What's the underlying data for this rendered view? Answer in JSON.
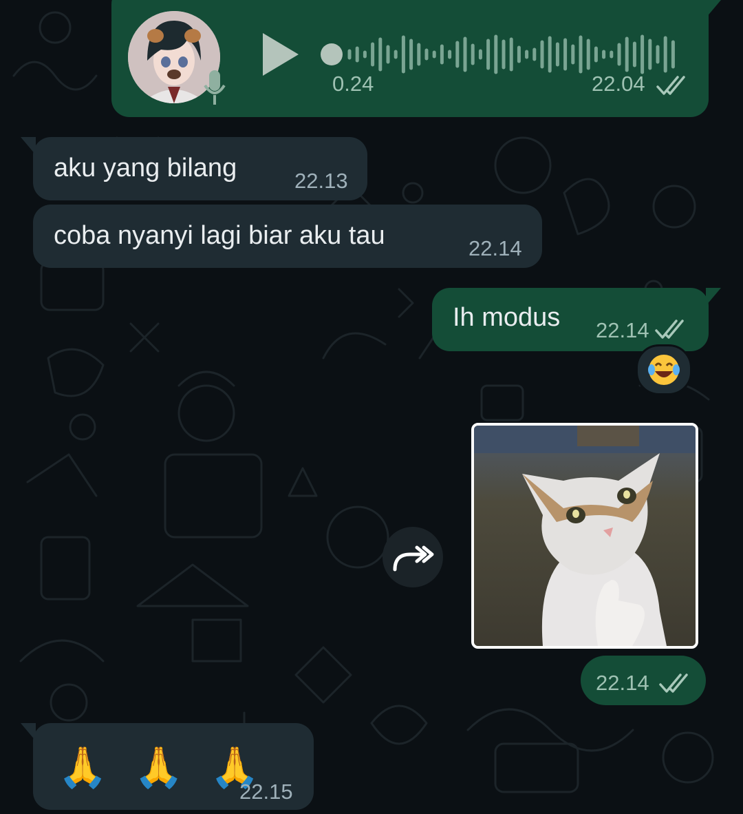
{
  "theme": {
    "background": "#0b1014",
    "incoming_bubble": "#1f2c33",
    "outgoing_bubble": "#144d37",
    "text": "#e9edef",
    "meta_text": "#9fb1ba",
    "read_ticks": "#a8c8ba"
  },
  "voice_note": {
    "duration": "0.24",
    "time": "22.04",
    "status_icon": "double-check-icon",
    "play_icon": "play-icon",
    "mic_icon": "microphone-icon"
  },
  "messages": [
    {
      "direction": "incoming",
      "text": "aku yang bilang",
      "time": "22.13"
    },
    {
      "direction": "incoming",
      "text": "coba nyanyi lagi biar aku tau",
      "time": "22.14"
    },
    {
      "direction": "outgoing",
      "text": "Ih modus",
      "time": "22.14",
      "status_icon": "double-check-icon",
      "reaction": "😂"
    },
    {
      "direction": "outgoing",
      "type": "sticker",
      "time": "22.14",
      "status_icon": "double-check-icon",
      "forward_icon": "forward-icon"
    },
    {
      "direction": "incoming",
      "text": "🙏 🙏 🙏",
      "time": "22.15"
    }
  ]
}
